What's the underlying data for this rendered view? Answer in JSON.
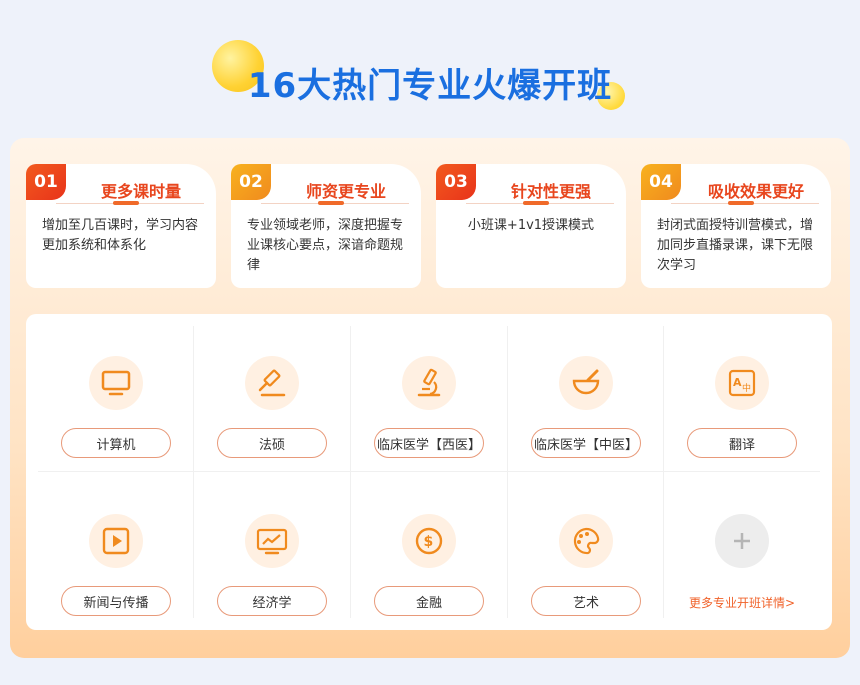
{
  "header": {
    "title": "16大热门专业火爆开班"
  },
  "colors": {
    "accent_red": "#e8461e",
    "accent_orange": "#f08a1e",
    "title_blue": "#1a6fe0"
  },
  "features": [
    {
      "num": "01",
      "title": "更多课时量",
      "desc": "增加至几百课时，学习内容更加系统和体系化"
    },
    {
      "num": "02",
      "title": "师资更专业",
      "desc": "专业领域老师，深度把握专业课核心要点，深谙命题规律"
    },
    {
      "num": "03",
      "title": "针对性更强",
      "desc": "小班课+1v1授课模式"
    },
    {
      "num": "04",
      "title": "吸收效果更好",
      "desc": "封闭式面授特训营模式，增加同步直播录课，课下无限次学习"
    }
  ],
  "majors": [
    {
      "label": "计算机",
      "icon": "monitor-icon"
    },
    {
      "label": "法硕",
      "icon": "gavel-icon"
    },
    {
      "label": "临床医学【西医】",
      "icon": "microscope-icon"
    },
    {
      "label": "临床医学【中医】",
      "icon": "mortar-pestle-icon"
    },
    {
      "label": "翻译",
      "icon": "translate-icon"
    },
    {
      "label": "新闻与传播",
      "icon": "play-video-icon"
    },
    {
      "label": "经济学",
      "icon": "chart-trend-icon"
    },
    {
      "label": "金融",
      "icon": "coin-icon"
    },
    {
      "label": "艺术",
      "icon": "palette-icon"
    }
  ],
  "more": {
    "label": "更多专业开班详情>",
    "icon": "plus-icon"
  }
}
